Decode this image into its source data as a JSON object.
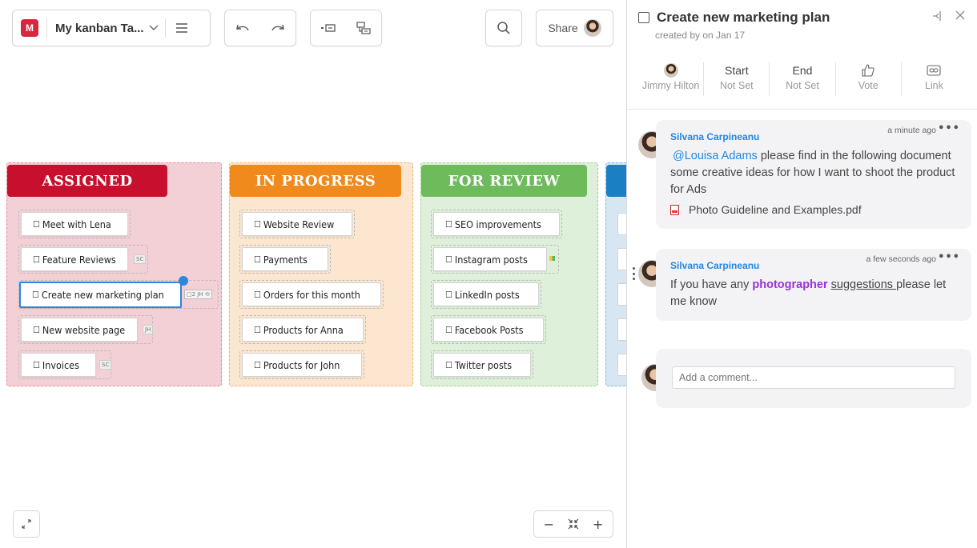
{
  "toolbar": {
    "logo": "M",
    "board_title": "My kanban Ta...",
    "share_label": "Share"
  },
  "columns": [
    {
      "title": "ASSIGNED",
      "color": "#c8102e",
      "bg": "#f2d0d6",
      "border": "#e88a9a",
      "cards": [
        {
          "label": "Meet with Lena",
          "tag": ""
        },
        {
          "label": "Feature Reviews",
          "tag": "SC"
        },
        {
          "label": "Create new marketing plan",
          "tag": "□2 JH ⟲"
        },
        {
          "label": "New website page",
          "tag": "JH"
        },
        {
          "label": "Invoices",
          "tag": "SC"
        }
      ]
    },
    {
      "title": "IN PROGRESS",
      "color": "#f08a1c",
      "bg": "#fce6cf",
      "border": "#f0b27a",
      "cards": [
        {
          "label": "Website Review"
        },
        {
          "label": "Payments"
        },
        {
          "label": "Orders for this month"
        },
        {
          "label": "Products for Anna"
        },
        {
          "label": "Products for John"
        }
      ]
    },
    {
      "title": "FOR REVIEW",
      "color": "#6dbb5b",
      "bg": "#def0da",
      "border": "#9fd091",
      "cards": [
        {
          "label": "SEO improvements"
        },
        {
          "label": "Instagram posts"
        },
        {
          "label": "LinkedIn posts"
        },
        {
          "label": "Facebook Posts"
        },
        {
          "label": "Twitter posts"
        }
      ]
    }
  ],
  "panel": {
    "title": "Create new marketing plan",
    "subtitle": "created by on Jan 17",
    "props": [
      {
        "top": "",
        "bottom": "Jimmy Hilton"
      },
      {
        "top": "Start",
        "bottom": "Not Set"
      },
      {
        "top": "End",
        "bottom": "Not Set"
      },
      {
        "top": "",
        "bottom": "Vote"
      },
      {
        "top": "",
        "bottom": "Link"
      }
    ],
    "comments": [
      {
        "author": "Silvana Carpineanu",
        "time": "a minute ago",
        "mention": "@Louisa Adams",
        "text_after_mention": " please find in the following document some creative ideas for how I want to shoot the product for Ads",
        "attachment": "Photo Guideline and Examples.pdf"
      },
      {
        "author": "Silvana Carpineanu",
        "time": "a few seconds ago",
        "t1": "If you have any ",
        "t2": "photographer",
        "t3": " ",
        "t4": "suggestions ",
        "t5": "please let me know"
      }
    ],
    "add_placeholder": "Add a comment..."
  }
}
